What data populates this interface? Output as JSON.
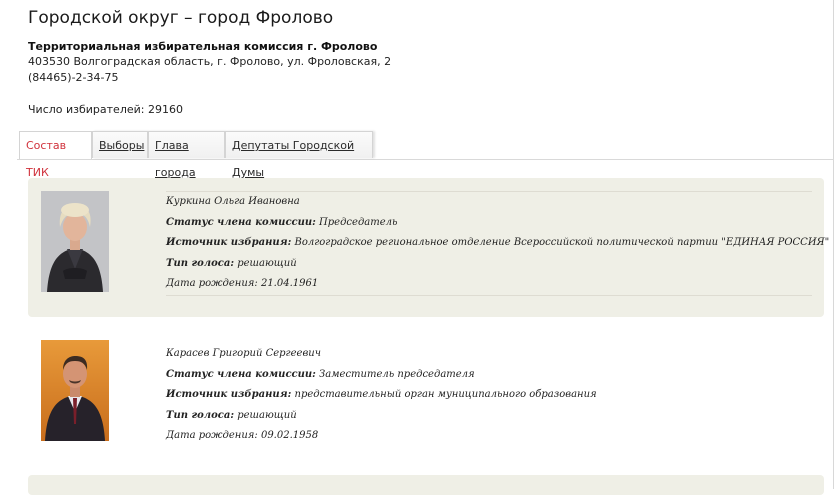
{
  "header": {
    "title": "Городской округ – город Фролово",
    "org_name": "Территориальная избирательная комиссия г. Фролово",
    "address": "403530 Волгоградская область, г. Фролово, ул. Фроловская, 2",
    "phone": "(84465)-2-34-75",
    "voters": "Число избирателей: 29160"
  },
  "tabs": [
    {
      "label": "Состав ТИК",
      "active": true
    },
    {
      "label": "Выборы",
      "active": false
    },
    {
      "label": "Глава города",
      "active": false
    },
    {
      "label": "Депутаты Городской Думы",
      "active": false
    }
  ],
  "labels": {
    "status": "Статус члена комиссии:",
    "source": "Источник избрания:",
    "vote": "Тип голоса:"
  },
  "members": [
    {
      "name": "Куркина Ольга Ивановна",
      "status": "Председатель",
      "source": "Волгоградское региональное отделение Всероссийской политической партии \"ЕДИНАЯ РОССИЯ\"",
      "vote": "решающий",
      "birth": "Дата рождения: 21.04.1961"
    },
    {
      "name": "Карасев Григорий Сергеевич",
      "status": "Заместитель председателя",
      "source": "представительный орган муниципального образования",
      "vote": "решающий",
      "birth": "Дата рождения: 09.02.1958"
    }
  ],
  "colors": {
    "active_tab": "#d0313b",
    "card_background": "#efefe6"
  }
}
